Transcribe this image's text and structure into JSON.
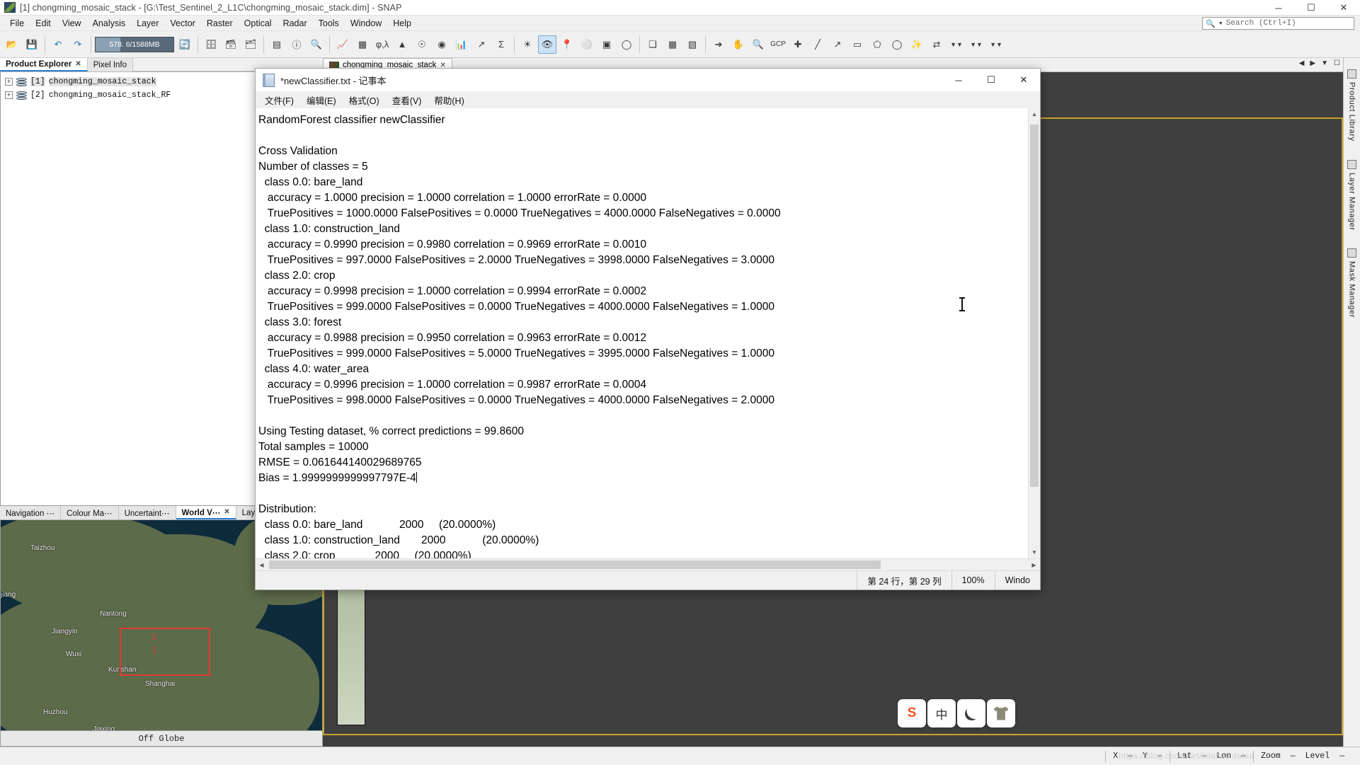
{
  "snap": {
    "title": "[1] chongming_mosaic_stack - [G:\\Test_Sentinel_2_L1C\\chongming_mosaic_stack.dim] - SNAP",
    "window_buttons": {
      "minimize": "─",
      "maximize": "☐",
      "close": "✕"
    },
    "menu": [
      "File",
      "Edit",
      "View",
      "Analysis",
      "Layer",
      "Vector",
      "Raster",
      "Optical",
      "Radar",
      "Tools",
      "Window",
      "Help"
    ],
    "search": {
      "placeholder": "Search (Ctrl+I)",
      "icon": "search-icon"
    },
    "toolbar": {
      "memory": "578. 6/1588MB",
      "icons": [
        "open-product-icon",
        "save-product-icon",
        "undo-icon",
        "redo-icon",
        "memory-gauge",
        "refresh-icon",
        "import-vector-icon",
        "import-raster-icon",
        "export-icon",
        "colour-manip-icon",
        "information-icon",
        "statistics-icon",
        "histogram-icon",
        "phase-lambda-icon",
        "profile-plot-icon",
        "metadata-icon",
        "scatter-plot-icon",
        "spectrum-view-icon",
        "correlative-plot-icon",
        "sigma-sum-icon",
        "mask-manager-icon",
        "pin-manager-icon",
        "gcp-manager-icon",
        "zoom-all-icon",
        "zoom-in-icon",
        "pan-icon",
        "select-icon",
        "magnifier-icon",
        "gcp-tool-icon",
        "line-draw-icon",
        "polyline-icon",
        "rectangle-icon",
        "polygon-icon",
        "ellipse-icon",
        "magic-wand-icon",
        "range-finder-icon",
        "chevron-down-icon",
        "chevron-down-icon",
        "chevron-down-icon"
      ]
    },
    "left_panel": {
      "tabs": [
        {
          "label": "Product Explorer",
          "closable": true,
          "active": true
        },
        {
          "label": "Pixel Info",
          "closable": false,
          "active": false
        }
      ],
      "products": [
        {
          "index": "[1]",
          "name": "chongming_mosaic_stack",
          "selected": true
        },
        {
          "index": "[2]",
          "name": "chongming_mosaic_stack_RF",
          "selected": false
        }
      ]
    },
    "bottom_panel": {
      "tabs": [
        {
          "label": "Navigation ⋯",
          "closable": false,
          "active": false
        },
        {
          "label": "Colour Ma⋯",
          "closable": false,
          "active": false
        },
        {
          "label": "Uncertaint⋯",
          "closable": false,
          "active": false
        },
        {
          "label": "World V⋯",
          "closable": true,
          "active": true
        },
        {
          "label": "Lay…",
          "closable": false,
          "active": false
        }
      ],
      "world_view": {
        "status": "Off Globe",
        "place_labels": [
          "Taizhou",
          "jiang",
          "Nantong",
          "Jiangyin",
          "Wuxi",
          "Kunshan",
          "Shanghai",
          "Huzhou",
          "Jiaxing"
        ],
        "selection_markers": [
          "2",
          "1"
        ]
      }
    },
    "document_tabs": [
      {
        "label": "chongming_mosaic_stack",
        "closable": true
      }
    ],
    "right_rail": [
      "Product Library",
      "Layer Manager",
      "Mask Manager"
    ],
    "statusbar": {
      "x_label": "X",
      "x_value": "—",
      "y_label": "Y",
      "y_value": "—",
      "lat_label": "Lat",
      "lat_value": "—",
      "lon_label": "Lon",
      "lon_value": "—",
      "zoom_label": "Zoom",
      "zoom_value": "—",
      "level_label": "Level",
      "level_value": "—",
      "watermark": "https://blog.csdn.net/lidahuilidahui"
    }
  },
  "notepad": {
    "title": "*newClassifier.txt - 记事本",
    "window_buttons": {
      "minimize": "─",
      "maximize": "☐",
      "close": "✕"
    },
    "menu": [
      "文件(F)",
      "编辑(E)",
      "格式(O)",
      "查看(V)",
      "帮助(H)"
    ],
    "content": "RandomForest classifier newClassifier\n\nCross Validation\nNumber of classes = 5\n  class 0.0: bare_land\n   accuracy = 1.0000 precision = 1.0000 correlation = 1.0000 errorRate = 0.0000\n   TruePositives = 1000.0000 FalsePositives = 0.0000 TrueNegatives = 4000.0000 FalseNegatives = 0.0000\n  class 1.0: construction_land\n   accuracy = 0.9990 precision = 0.9980 correlation = 0.9969 errorRate = 0.0010\n   TruePositives = 997.0000 FalsePositives = 2.0000 TrueNegatives = 3998.0000 FalseNegatives = 3.0000\n  class 2.0: crop\n   accuracy = 0.9998 precision = 1.0000 correlation = 0.9994 errorRate = 0.0002\n   TruePositives = 999.0000 FalsePositives = 0.0000 TrueNegatives = 4000.0000 FalseNegatives = 1.0000\n  class 3.0: forest\n   accuracy = 0.9988 precision = 0.9950 correlation = 0.9963 errorRate = 0.0012\n   TruePositives = 999.0000 FalsePositives = 5.0000 TrueNegatives = 3995.0000 FalseNegatives = 1.0000\n  class 4.0: water_area\n   accuracy = 0.9996 precision = 1.0000 correlation = 0.9987 errorRate = 0.0004\n   TruePositives = 998.0000 FalsePositives = 0.0000 TrueNegatives = 4000.0000 FalseNegatives = 2.0000\n\nUsing Testing dataset, % correct predictions = 99.8600\nTotal samples = 10000\nRMSE = 0.061644140029689765\nBias = 1.9999999999997797E-4",
    "content_tail": "\n\nDistribution:\n  class 0.0: bare_land            2000     (20.0000%)\n  class 1.0: construction_land       2000            (20.0000%)\n  class 2.0: crop             2000     (20.0000%)",
    "statusbar": {
      "position": "第 24 行，第 29 列",
      "zoom": "100%",
      "encoding": "Windo"
    }
  },
  "ime": {
    "keys": [
      "sogou-logo-icon",
      "中",
      "moon-icon",
      "shirt-icon"
    ]
  }
}
